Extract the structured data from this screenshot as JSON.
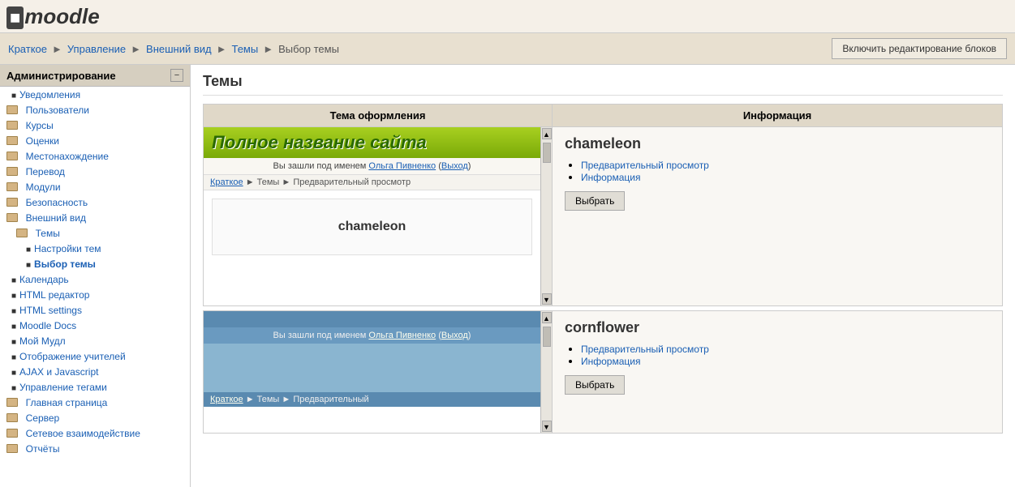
{
  "logo": {
    "text": "moodle"
  },
  "breadcrumb": {
    "items": [
      "Краткое",
      "Управление",
      "Внешний вид",
      "Темы",
      "Выбор темы"
    ],
    "separators": [
      "►",
      "►",
      "►",
      "►"
    ]
  },
  "edit_blocks_button": "Включить редактирование блоков",
  "sidebar": {
    "title": "Администрирование",
    "items": [
      {
        "label": "Уведомления",
        "indent": 1,
        "type": "bullet"
      },
      {
        "label": "Пользователи",
        "indent": 1,
        "type": "folder"
      },
      {
        "label": "Курсы",
        "indent": 1,
        "type": "folder"
      },
      {
        "label": "Оценки",
        "indent": 1,
        "type": "folder"
      },
      {
        "label": "Местонахождение",
        "indent": 1,
        "type": "folder"
      },
      {
        "label": "Перевод",
        "indent": 1,
        "type": "folder"
      },
      {
        "label": "Модули",
        "indent": 1,
        "type": "folder"
      },
      {
        "label": "Безопасность",
        "indent": 1,
        "type": "folder"
      },
      {
        "label": "Внешний вид",
        "indent": 1,
        "type": "folder-open"
      },
      {
        "label": "Темы",
        "indent": 2,
        "type": "folder-open"
      },
      {
        "label": "Настройки тем",
        "indent": 3,
        "type": "bullet"
      },
      {
        "label": "Выбор темы",
        "indent": 3,
        "type": "bullet",
        "active": true
      },
      {
        "label": "Календарь",
        "indent": 1,
        "type": "bullet"
      },
      {
        "label": "HTML редактор",
        "indent": 1,
        "type": "bullet"
      },
      {
        "label": "HTML settings",
        "indent": 1,
        "type": "bullet"
      },
      {
        "label": "Moodle Docs",
        "indent": 1,
        "type": "bullet"
      },
      {
        "label": "Мой Мудл",
        "indent": 1,
        "type": "bullet"
      },
      {
        "label": "Отображение учителей",
        "indent": 1,
        "type": "bullet"
      },
      {
        "label": "AJAX и Javascript",
        "indent": 1,
        "type": "bullet"
      },
      {
        "label": "Управление тегами",
        "indent": 1,
        "type": "bullet"
      },
      {
        "label": "Главная страница",
        "indent": 0,
        "type": "folder"
      },
      {
        "label": "Сервер",
        "indent": 0,
        "type": "folder"
      },
      {
        "label": "Сетевое взаимодействие",
        "indent": 0,
        "type": "folder"
      },
      {
        "label": "Отчёты",
        "indent": 0,
        "type": "folder"
      }
    ]
  },
  "page": {
    "title": "Темы",
    "table": {
      "col1": "Тема оформления",
      "col2": "Информация"
    }
  },
  "themes": [
    {
      "id": "chameleon",
      "name": "chameleon",
      "preview": {
        "site_title": "Полное название сайта",
        "login_text": "Вы зашли под именем",
        "user": "Ольга Пивненко",
        "logout": "Выход",
        "breadcrumb": "Краткое ► Темы ► Предварительный просмотр",
        "theme_name": "chameleon"
      },
      "info_links": [
        "Предварительный просмотр",
        "Информация"
      ],
      "select_label": "Выбрать"
    },
    {
      "id": "cornflower",
      "name": "cornflower",
      "preview": {
        "login_text": "Вы зашли под именем",
        "user": "Ольга Пивненко",
        "logout": "Выход",
        "breadcrumb": "Краткое ► Темы ► Предварительный"
      },
      "info_links": [
        "Предварительный просмотр",
        "Информация"
      ],
      "select_label": "Выбрать"
    }
  ]
}
